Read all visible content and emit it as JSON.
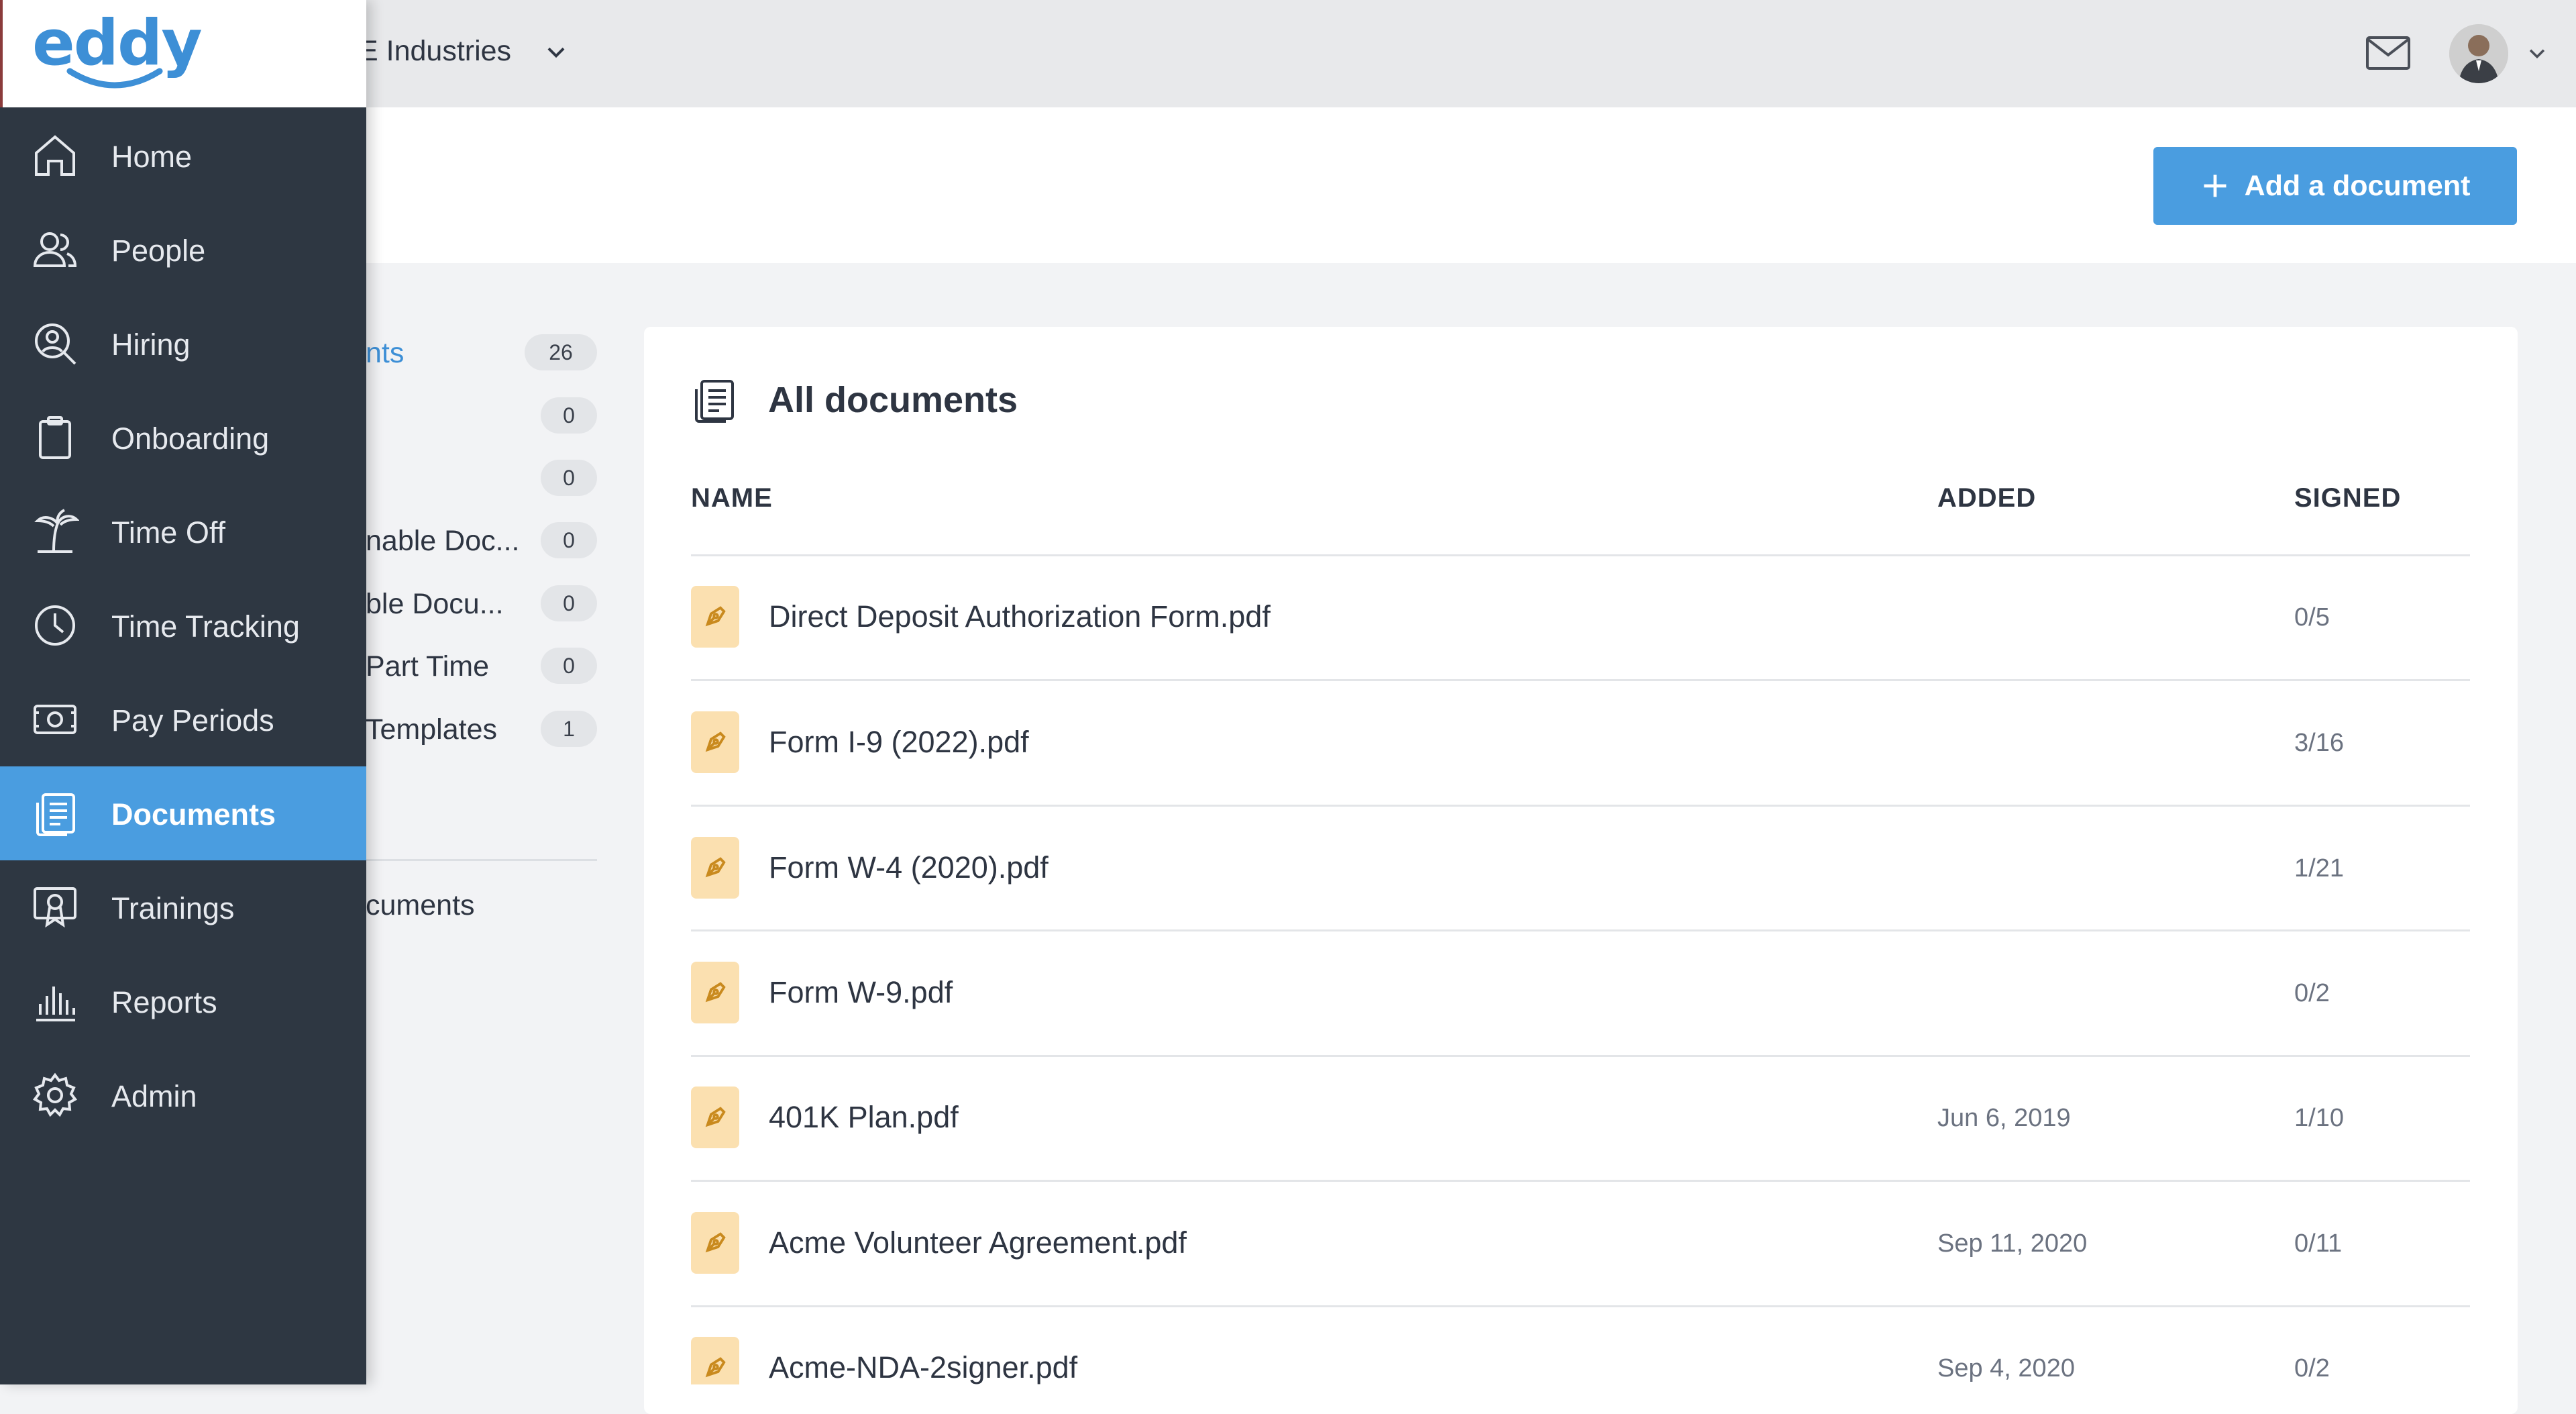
{
  "app": {
    "logo_text": "eddy",
    "company_name": "E Industries"
  },
  "sidebar": {
    "items": [
      {
        "label": "Home",
        "icon": "home-icon"
      },
      {
        "label": "People",
        "icon": "people-icon"
      },
      {
        "label": "Hiring",
        "icon": "hiring-icon"
      },
      {
        "label": "Onboarding",
        "icon": "clipboard-icon"
      },
      {
        "label": "Time Off",
        "icon": "palm-tree-icon"
      },
      {
        "label": "Time Tracking",
        "icon": "clock-icon"
      },
      {
        "label": "Pay Periods",
        "icon": "money-icon"
      },
      {
        "label": "Documents",
        "icon": "documents-icon",
        "active": true
      },
      {
        "label": "Trainings",
        "icon": "trainings-icon"
      },
      {
        "label": "Reports",
        "icon": "bar-chart-icon"
      },
      {
        "label": "Admin",
        "icon": "gear-icon"
      }
    ]
  },
  "header": {
    "add_button_label": "Add a document"
  },
  "folders": {
    "items": [
      {
        "label": "nts",
        "count": "26"
      },
      {
        "label": "",
        "count": "0"
      },
      {
        "label": "",
        "count": "0"
      },
      {
        "label": "nable Doc...",
        "count": "0"
      },
      {
        "label": "ble Docu...",
        "count": "0"
      },
      {
        "label": "Part Time",
        "count": "0"
      },
      {
        "label": "Templates",
        "count": "1"
      }
    ],
    "other_label": "cuments"
  },
  "main": {
    "title": "All documents",
    "columns": {
      "name": "NAME",
      "added": "ADDED",
      "signed": "SIGNED"
    },
    "rows": [
      {
        "name": "Direct Deposit Authorization Form.pdf",
        "added": "",
        "signed": "0/5"
      },
      {
        "name": "Form I-9 (2022).pdf",
        "added": "",
        "signed": "3/16"
      },
      {
        "name": "Form W-4 (2020).pdf",
        "added": "",
        "signed": "1/21"
      },
      {
        "name": "Form W-9.pdf",
        "added": "",
        "signed": "0/2"
      },
      {
        "name": "401K Plan.pdf",
        "added": "Jun 6, 2019",
        "signed": "1/10"
      },
      {
        "name": "Acme Volunteer Agreement.pdf",
        "added": "Sep 11, 2020",
        "signed": "0/11"
      },
      {
        "name": "Acme-NDA-2signer.pdf",
        "added": "Sep 4, 2020",
        "signed": "0/2"
      }
    ]
  },
  "colors": {
    "accent": "#4a9de0",
    "sidebar_bg": "#2e3742",
    "doc_icon_bg": "#fbe0b0",
    "doc_icon_fg": "#c98a1e"
  }
}
